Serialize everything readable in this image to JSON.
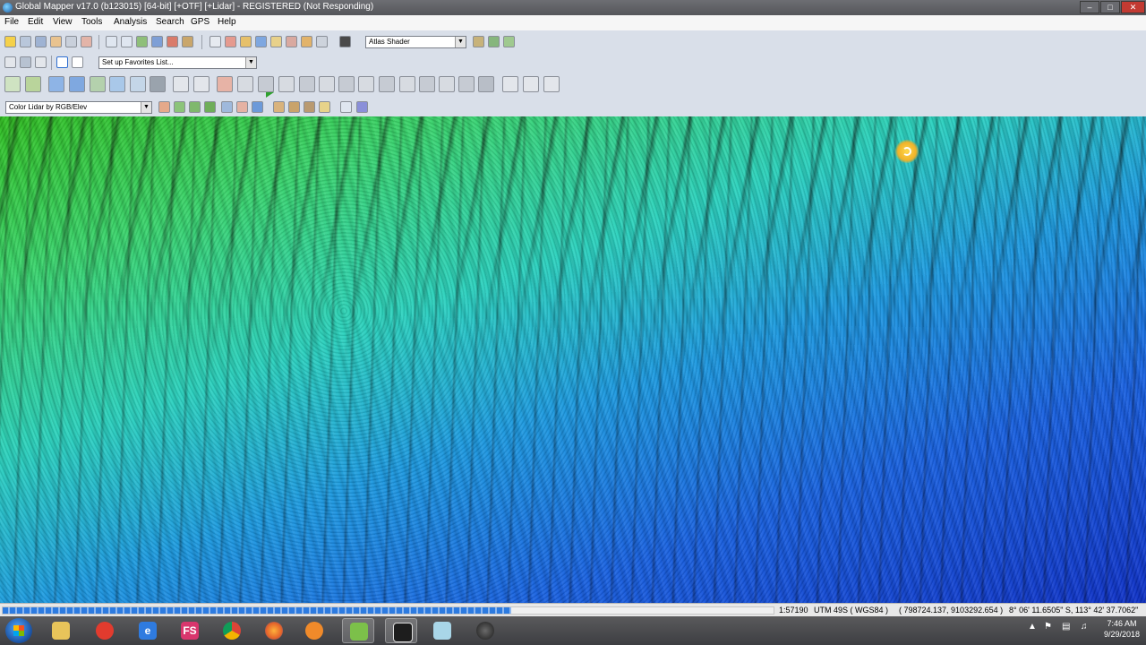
{
  "window": {
    "title": "Global Mapper v17.0 (b123015) [64-bit] [+OTF] [+Lidar] - REGISTERED (Not Responding)"
  },
  "menubar": {
    "items": [
      "File",
      "Edit",
      "View",
      "Tools",
      "Analysis",
      "Search",
      "GPS",
      "Help"
    ]
  },
  "toolbar": {
    "shader_select": "Atlas Shader",
    "favorites_select": "Set up Favorites List...",
    "lidar_color_select": "Color Lidar by RGB/Elev"
  },
  "statusbar": {
    "progress_fraction": 0.66,
    "scale": "1:57190",
    "projection": "UTM 49S  ( WGS84 )",
    "coords": "( 798724.137, 9103292.654 )",
    "latlon": "8° 06' 11.6505\" S, 113° 42' 37.7062\""
  },
  "taskbar": {
    "time": "7:46 AM",
    "date": "9/29/2018",
    "apps": [
      {
        "name": "windows-explorer",
        "label": ""
      },
      {
        "name": "screen-recorder",
        "label": ""
      },
      {
        "name": "internet-explorer",
        "label": "e"
      },
      {
        "name": "fs-app",
        "label": "FS"
      },
      {
        "name": "chrome",
        "label": ""
      },
      {
        "name": "firefox",
        "label": ""
      },
      {
        "name": "media-player",
        "label": ""
      },
      {
        "name": "global-mapper",
        "label": ""
      },
      {
        "name": "terminal-app",
        "label": ""
      },
      {
        "name": "file-app",
        "label": ""
      },
      {
        "name": "globe-app",
        "label": ""
      }
    ]
  }
}
